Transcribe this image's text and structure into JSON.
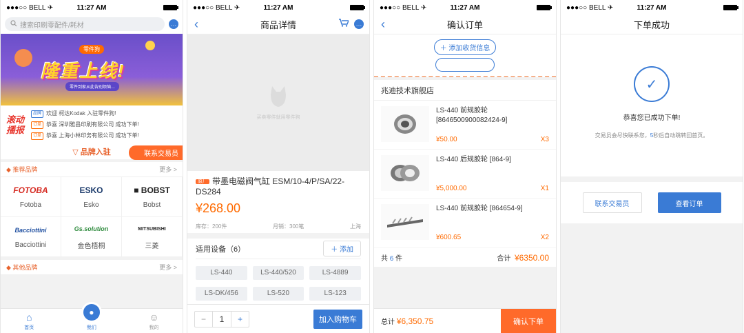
{
  "status": {
    "carrier": "●●●○○ BELL ✈",
    "time": "11:27 AM"
  },
  "screen1": {
    "search_placeholder": "搜索印刷零配件/耗材",
    "banner": {
      "badge": "零件狗",
      "headline": "隆重上线!",
      "sub": "零件到家从此告别烦恼…"
    },
    "news_label": "滚动播报",
    "news": [
      {
        "tag": "品牌",
        "text": "欢迎 柯达Kodak 入驻零件狗!"
      },
      {
        "tag": "订单",
        "text": "恭喜 深圳雅昌印刷有限公司 成功下单!"
      },
      {
        "tag": "订单",
        "text": "恭喜 上海小林印务有限公司 成功下单!"
      }
    ],
    "brand_entry": "品牌入驻",
    "contact": "联系交易员",
    "recommended_title": "推荐品牌",
    "more": "更多 >",
    "brands": [
      {
        "logo": "FOTOBA",
        "name": "Fotoba",
        "color": "#d62b22"
      },
      {
        "logo": "ESKO",
        "name": "Esko",
        "color": "#1b3a6b"
      },
      {
        "logo": "■ BOBST",
        "name": "Bobst",
        "color": "#222222"
      },
      {
        "logo": "Bacciottini",
        "name": "Bacciottini",
        "color": "#1f4fa0"
      },
      {
        "logo": "Gs.solution",
        "name": "金色梧桐",
        "color": "#2d8a3c"
      },
      {
        "logo": "MITSUBISHI",
        "name": "三菱",
        "color": "#d62b22"
      }
    ],
    "other_title": "其他品牌",
    "other_more": "更多 >",
    "tabs": {
      "home": "首页",
      "center": "我们",
      "mine": "我的"
    }
  },
  "screen2": {
    "title": "商品详情",
    "placeholder_text": "买卖零件就用零件狗",
    "hot_tag": "原厂",
    "product_name": "带墨电磁阀气缸 ESM/10-4/P/SA/22-DS284",
    "price": "¥268.00",
    "stock": "库存：200件",
    "sold": "月销：300笔",
    "location": "上海",
    "equip_title": "适用设备（6）",
    "add_label": "＋ 添加",
    "chips": [
      "LS-440",
      "LS-440/520",
      "LS-4889",
      "LS-DK/456",
      "LS-520",
      "LS-123"
    ],
    "qty": "1",
    "add_to_cart": "加入购物车"
  },
  "screen3": {
    "title": "确认订单",
    "add_address": "＋ 添加收货信息",
    "store": "兆迪技术旗舰店",
    "items": [
      {
        "name": "LS-440 前规胶轮 [8646500900082424-9]",
        "price": "¥50.00",
        "qty": "X3"
      },
      {
        "name": "LS-440 后规胶轮 [864-9]",
        "price": "¥5,000.00",
        "qty": "X1"
      },
      {
        "name": "LS-440 前规胶轮 [864654-9]",
        "price": "¥600.65",
        "qty": "X2"
      }
    ],
    "count_prefix": "共",
    "count": "6",
    "count_suffix": "件",
    "subtotal_label": "合计",
    "subtotal": "¥6350.00",
    "total_label": "总计",
    "total": "¥6,350.75",
    "confirm": "确认下单"
  },
  "screen4": {
    "title": "下单成功",
    "success_title": "恭喜您已成功下单!",
    "desc_prefix": "交易员会尽快联系您，",
    "seconds": "5",
    "desc_suffix": "秒后自动跳转回首页。",
    "contact": "联系交易员",
    "view_order": "查看订单"
  }
}
